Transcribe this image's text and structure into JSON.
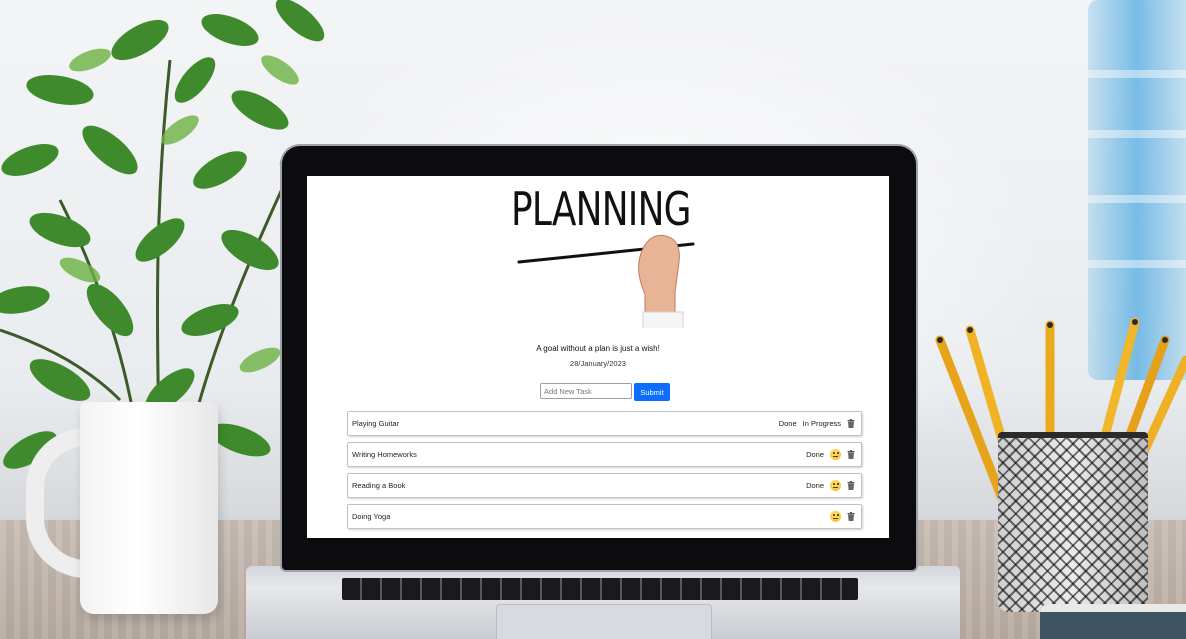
{
  "screen": {
    "hero_title": "PLANNING",
    "motto": "A goal without a plan is just a wish!",
    "date": "28/January/2023",
    "form": {
      "input_placeholder": "Add New Task",
      "input_value": "",
      "submit_label": "Submit"
    },
    "tasks": [
      {
        "name": "Playing Guitar",
        "done_label": "Done",
        "status_label": "In Progress",
        "status_icon": null,
        "delete_icon": "trash-icon"
      },
      {
        "name": "Writing Homeworks",
        "done_label": "Done",
        "status_label": null,
        "status_icon": "thinking-face-icon",
        "delete_icon": "trash-icon"
      },
      {
        "name": "Reading a Book",
        "done_label": "Done",
        "status_label": null,
        "status_icon": "thinking-face-icon",
        "delete_icon": "trash-icon"
      },
      {
        "name": "Doing Yoga",
        "done_label": null,
        "status_label": null,
        "status_icon": "grinning-face-icon",
        "delete_icon": "trash-icon"
      }
    ]
  },
  "colors": {
    "submit_button": "#0d6efd",
    "row_border": "#bfc3c8"
  }
}
